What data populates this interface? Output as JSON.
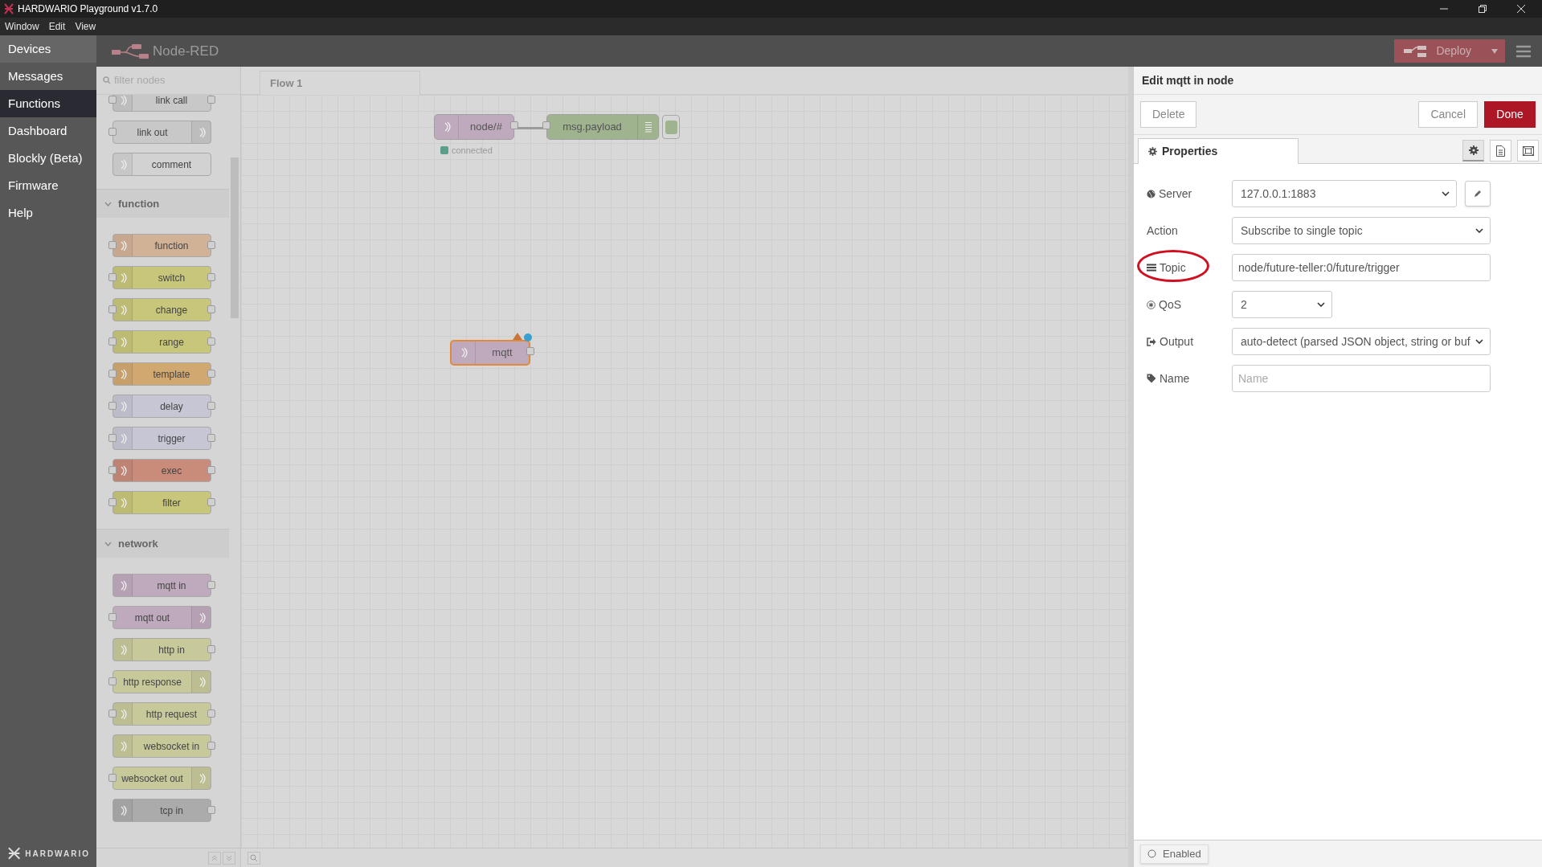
{
  "window": {
    "title": "HARDWARIO Playground v1.7.0"
  },
  "menu": [
    "Window",
    "Edit",
    "View"
  ],
  "app_nav": [
    {
      "label": "Devices",
      "selected": false
    },
    {
      "label": "Messages",
      "selected": false
    },
    {
      "label": "Functions",
      "selected": true
    },
    {
      "label": "Dashboard",
      "selected": false
    },
    {
      "label": "Blockly (Beta)",
      "selected": false
    },
    {
      "label": "Firmware",
      "selected": false
    },
    {
      "label": "Help",
      "selected": false
    }
  ],
  "app_logo": "HARDWARIO",
  "header": {
    "title": "Node-RED",
    "deploy": "Deploy"
  },
  "palette": {
    "placeholder": "filter nodes",
    "top_nodes": [
      {
        "label": "link call",
        "kind": "both",
        "color": "#c8c8c8"
      },
      {
        "label": "link out",
        "kind": "input",
        "color": "#c8c8c8"
      },
      {
        "label": "comment",
        "kind": "none",
        "color": "#d2d2d2"
      }
    ],
    "categories": [
      {
        "name": "function",
        "expanded": true,
        "nodes": [
          {
            "label": "function",
            "kind": "both",
            "color": "#d2b296"
          },
          {
            "label": "switch",
            "kind": "both",
            "color": "#c8c67a"
          },
          {
            "label": "change",
            "kind": "both",
            "color": "#c8c67a"
          },
          {
            "label": "range",
            "kind": "both",
            "color": "#c8c67a"
          },
          {
            "label": "template",
            "kind": "both",
            "color": "#d1a870"
          },
          {
            "label": "delay",
            "kind": "both",
            "color": "#c6c6d4"
          },
          {
            "label": "trigger",
            "kind": "both",
            "color": "#c6c6d4"
          },
          {
            "label": "exec",
            "kind": "both",
            "color": "#c98b7a"
          },
          {
            "label": "filter",
            "kind": "both",
            "color": "#c8c67a"
          }
        ]
      },
      {
        "name": "network",
        "expanded": true,
        "nodes": [
          {
            "label": "mqtt in",
            "kind": "output",
            "color": "#bfaabd"
          },
          {
            "label": "mqtt out",
            "kind": "input",
            "color": "#bfaabd"
          },
          {
            "label": "http in",
            "kind": "output",
            "color": "#c7c99a"
          },
          {
            "label": "http response",
            "kind": "input",
            "color": "#c7c99a"
          },
          {
            "label": "http request",
            "kind": "both",
            "color": "#c7c99a"
          },
          {
            "label": "websocket in",
            "kind": "output",
            "color": "#c7c99a"
          },
          {
            "label": "websocket out",
            "kind": "input",
            "color": "#c7c99a"
          },
          {
            "label": "tcp in",
            "kind": "output",
            "color": "#ababab"
          }
        ]
      }
    ]
  },
  "workspace": {
    "tabs": [
      {
        "label": "Flow 1",
        "selected": true
      }
    ],
    "nodes": [
      {
        "label": "node/#",
        "kind": "output",
        "color": "#bfaabd",
        "selected": false,
        "changed": false,
        "invalid": false,
        "status": {
          "text": "connected",
          "color": "#5b9e8a"
        }
      },
      {
        "label": "msg.payload",
        "kind": "debug",
        "color": "#9fb38e",
        "selected": false,
        "changed": false,
        "invalid": false
      },
      {
        "label": "mqtt",
        "kind": "output",
        "color": "#bfaabd",
        "selected": true,
        "changed": true,
        "invalid": true
      }
    ]
  },
  "editor": {
    "title": "Edit mqtt in node",
    "delete": "Delete",
    "cancel": "Cancel",
    "done": "Done",
    "tabs": [
      {
        "label": "Properties",
        "selected": true
      }
    ],
    "fields": [
      {
        "label": "Server",
        "kind": "select",
        "value": "127.0.0.1:1883",
        "editable": true,
        "highlighted": false
      },
      {
        "label": "Action",
        "kind": "select",
        "value": "Subscribe to single topic",
        "editable": false,
        "highlighted": false
      },
      {
        "label": "Topic",
        "kind": "input",
        "value": "node/future-teller:0/future/trigger",
        "editable": false,
        "highlighted": true
      },
      {
        "label": "QoS",
        "kind": "short-select",
        "value": "2",
        "editable": false,
        "highlighted": false
      },
      {
        "label": "Output",
        "kind": "select",
        "value": "auto-detect (parsed JSON object, string or buf",
        "editable": false,
        "highlighted": false
      },
      {
        "label": "Name",
        "kind": "input",
        "placeholder": "Name",
        "editable": false,
        "highlighted": false
      }
    ],
    "enabled": "Enabled"
  }
}
